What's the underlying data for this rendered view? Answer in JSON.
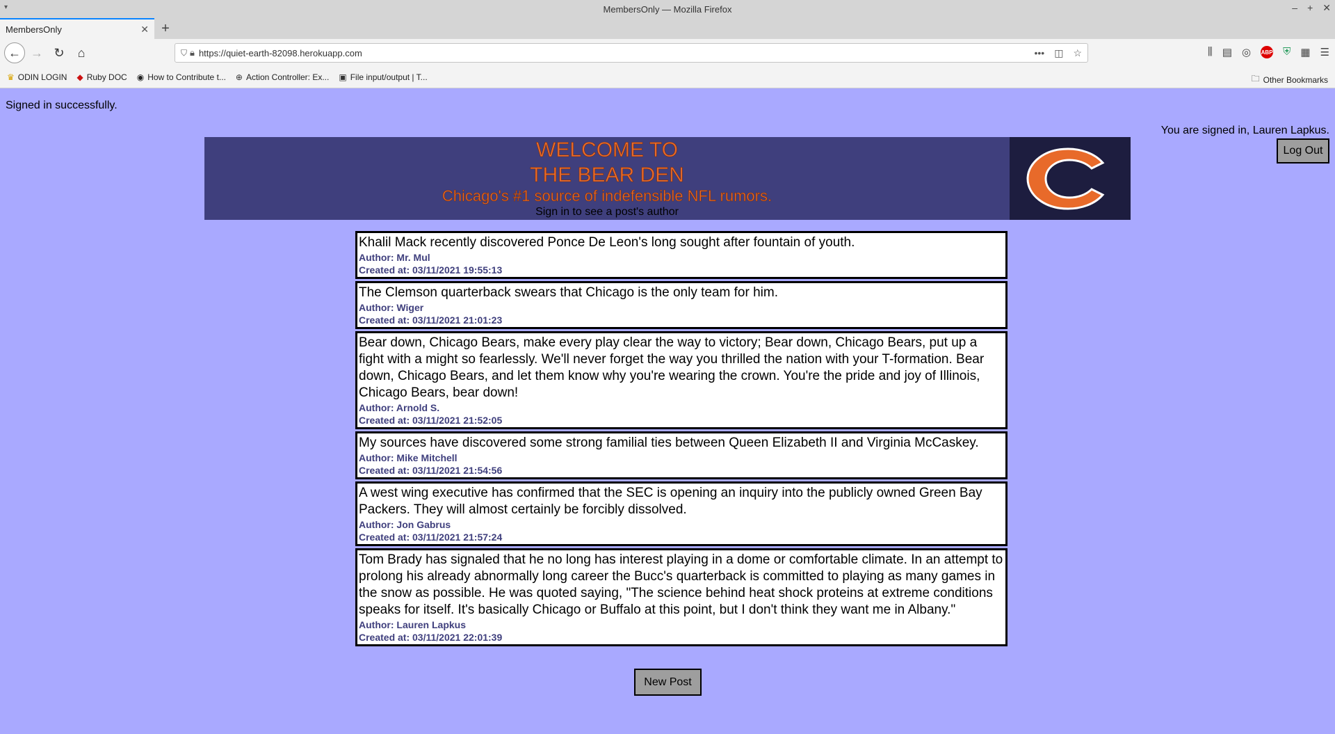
{
  "window": {
    "title": "MembersOnly — Mozilla Firefox",
    "controls": [
      "–",
      "+",
      "✕"
    ]
  },
  "tab": {
    "title": "MembersOnly"
  },
  "url": "https://quiet-earth-82098.herokuapp.com",
  "bookmarks": [
    {
      "label": "ODIN LOGIN",
      "icon": "cone-icon",
      "glyph": "♛",
      "color": "#d9a300"
    },
    {
      "label": "Ruby DOC",
      "icon": "ruby-icon",
      "glyph": "◆",
      "color": "#cc1111"
    },
    {
      "label": "How to Contribute t...",
      "icon": "github-icon",
      "glyph": "◉",
      "color": "#222222"
    },
    {
      "label": "Action Controller: Ex...",
      "icon": "globe-icon",
      "glyph": "⊕",
      "color": "#333333"
    },
    {
      "label": "File input/output | T...",
      "icon": "odin-icon",
      "glyph": "▣",
      "color": "#333333"
    }
  ],
  "other_bookmarks": "Other Bookmarks",
  "flash": "Signed in successfully.",
  "signed_in": "You are signed in, Lauren Lapkus.",
  "logout": "Log Out",
  "banner": {
    "line1": "WELCOME TO",
    "line2": "THE BEAR DEN",
    "line3": "Chicago's #1 source of indefensible NFL rumors.",
    "hint": "Sign in to see a post's author"
  },
  "posts": [
    {
      "text": "Khalil Mack recently discovered Ponce De Leon's long sought after fountain of youth.",
      "author": "Author: Mr. Mul",
      "created": "Created at: 03/11/2021 19:55:13"
    },
    {
      "text": "The Clemson quarterback swears that Chicago is the only team for him.",
      "author": "Author: Wiger",
      "created": "Created at: 03/11/2021 21:01:23"
    },
    {
      "text": "Bear down, Chicago Bears, make every play clear the way to victory; Bear down, Chicago Bears, put up a fight with a might so fearlessly. We'll never forget the way you thrilled the nation with your T-formation. Bear down, Chicago Bears, and let them know why you're wearing the crown. You're the pride and joy of Illinois, Chicago Bears, bear down!",
      "author": "Author: Arnold S.",
      "created": "Created at: 03/11/2021 21:52:05"
    },
    {
      "text": "My sources have discovered some strong familial ties between Queen Elizabeth II and Virginia McCaskey.",
      "author": "Author: Mike Mitchell",
      "created": "Created at: 03/11/2021 21:54:56"
    },
    {
      "text": "A west wing executive has confirmed that the SEC is opening an inquiry into the publicly owned Green Bay Packers. They will almost certainly be forcibly dissolved.",
      "author": "Author: Jon Gabrus",
      "created": "Created at: 03/11/2021 21:57:24"
    },
    {
      "text": "Tom Brady has signaled that he no long has interest playing in a dome or comfortable climate. In an attempt to prolong his already abnormally long career the Bucc's quarterback is committed to playing as many games in the snow as possible. He was quoted saying, \"The science behind heat shock proteins at extreme conditions speaks for itself. It's basically Chicago or Buffalo at this point, but I don't think they want me in Albany.\"",
      "author": "Author: Lauren Lapkus",
      "created": "Created at: 03/11/2021 22:01:39"
    }
  ],
  "new_post": "New Post",
  "colors": {
    "page_bg": "#a9a9ff",
    "banner_bg": "#3f3f7d",
    "accent_orange": "#e86a2a",
    "meta_text": "#3f3f7d"
  }
}
